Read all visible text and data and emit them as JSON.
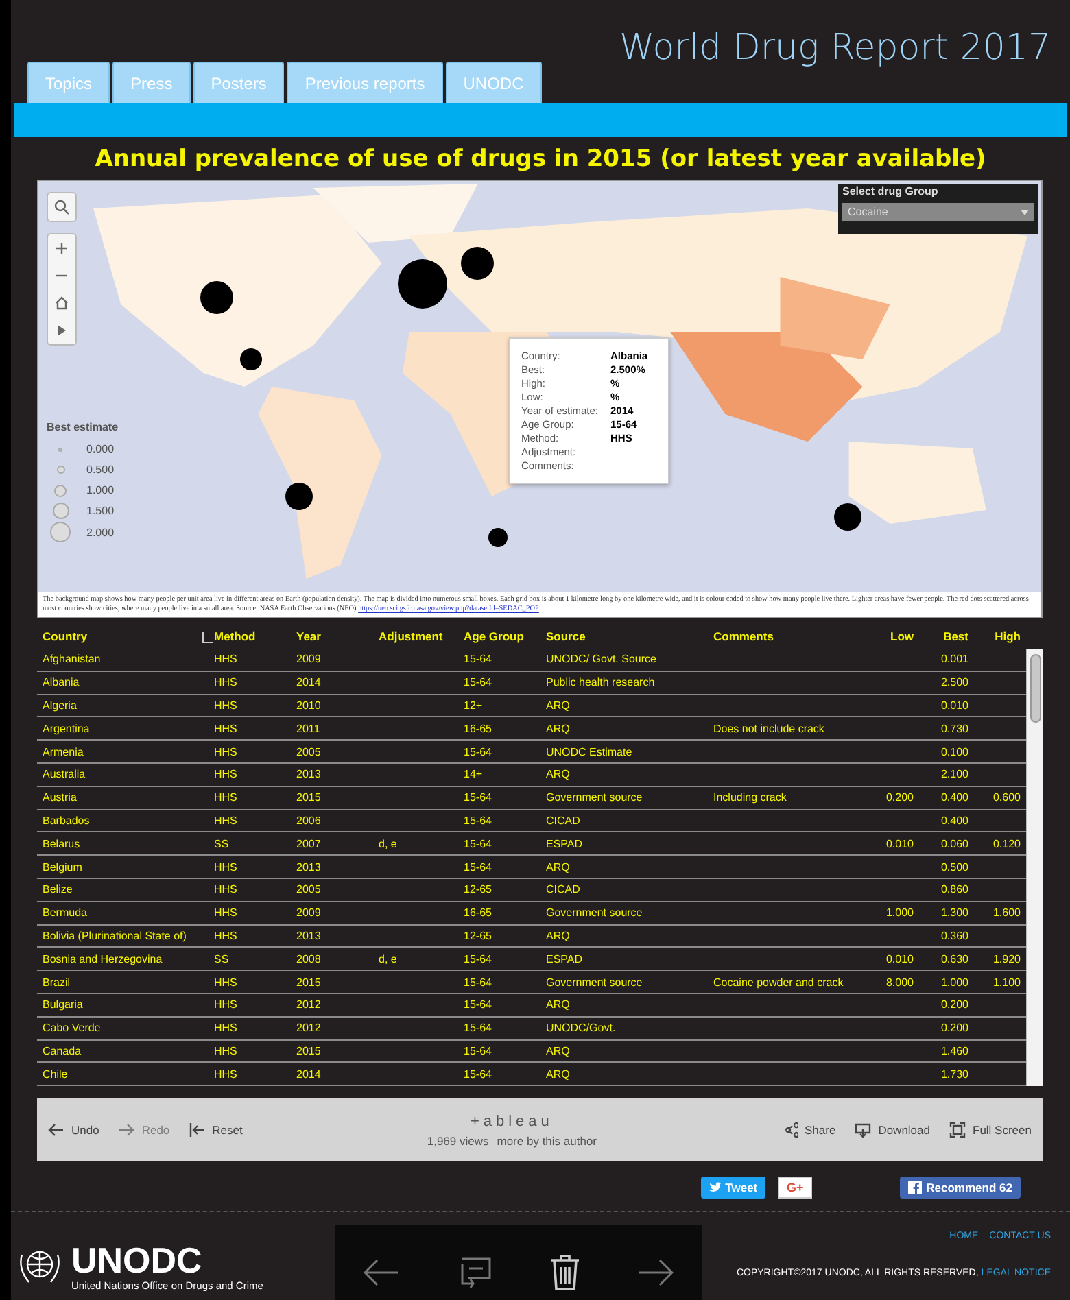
{
  "header": {
    "title": "World Drug Report 2017",
    "tabs": [
      "Topics",
      "Press",
      "Posters",
      "Previous reports",
      "UNODC"
    ]
  },
  "chart_title": "Annual prevalence of use of drugs in 2015 (or latest year available)",
  "map": {
    "kind": "picture",
    "drug_group": {
      "label": "Select drug Group",
      "value": "Cocaine"
    },
    "legend": {
      "title": "Best estimate",
      "items": [
        "0.000",
        "0.500",
        "1.000",
        "1.500",
        "2.000"
      ]
    },
    "tooltip": [
      {
        "label": "Country:",
        "value": "Albania"
      },
      {
        "label": "Best:",
        "value": "2.500%"
      },
      {
        "label": "High:",
        "value": "%"
      },
      {
        "label": "Low:",
        "value": "%"
      },
      {
        "label": "Year of estimate:",
        "value": "2014"
      },
      {
        "label": "Age Group:",
        "value": "15-64"
      },
      {
        "label": "Method:",
        "value": "HHS"
      },
      {
        "label": "Adjustment:"
      },
      {
        "label": "Comments:"
      }
    ],
    "caption": "The background map shows how many people per unit area live in different areas on Earth (population density). The map is divided into numerous small boxes. Each grid box is about 1 kilometre long by one kilometre wide, and it is colour coded to show how many people live there. Lighter areas have fewer people. The red dots scattered across most countries show cities, where many people live in a small area. Source: NASA Earth Observations (NEO)",
    "caption_link": "https://neo.sci.gsfc.nasa.gov/view.php?datasetId=SEDAC_POP"
  },
  "table": {
    "columns": [
      "Country",
      "Method",
      "Year",
      "Adjustment",
      "Age Group",
      "Source",
      "Comments",
      "Low",
      "Best",
      "High"
    ],
    "rows": [
      [
        "Afghanistan",
        "HHS",
        "2009",
        "",
        "15-64",
        "UNODC/ Govt. Source",
        "",
        "",
        "0.001",
        ""
      ],
      [
        "Albania",
        "HHS",
        "2014",
        "",
        "15-64",
        "Public health research",
        "",
        "",
        "2.500",
        ""
      ],
      [
        "Algeria",
        "HHS",
        "2010",
        "",
        "12+",
        "ARQ",
        "",
        "",
        "0.010",
        ""
      ],
      [
        "Argentina",
        "HHS",
        "2011",
        "",
        "16-65",
        "ARQ",
        "Does not include crack",
        "",
        "0.730",
        ""
      ],
      [
        "Armenia",
        "HHS",
        "2005",
        "",
        "15-64",
        "UNODC Estimate",
        "",
        "",
        "0.100",
        ""
      ],
      [
        "Australia",
        "HHS",
        "2013",
        "",
        "14+",
        "ARQ",
        "",
        "",
        "2.100",
        ""
      ],
      [
        "Austria",
        "HHS",
        "2015",
        "",
        "15-64",
        "Government source",
        "Including crack",
        "0.200",
        "0.400",
        "0.600"
      ],
      [
        "Barbados",
        "HHS",
        "2006",
        "",
        "15-64",
        "CICAD",
        "",
        "",
        "0.400",
        ""
      ],
      [
        "Belarus",
        "SS",
        "2007",
        "d, e",
        "15-64",
        "ESPAD",
        "",
        "0.010",
        "0.060",
        "0.120"
      ],
      [
        "Belgium",
        "HHS",
        "2013",
        "",
        "15-64",
        "ARQ",
        "",
        "",
        "0.500",
        ""
      ],
      [
        "Belize",
        "HHS",
        "2005",
        "",
        "12-65",
        "CICAD",
        "",
        "",
        "0.860",
        ""
      ],
      [
        "Bermuda",
        "HHS",
        "2009",
        "",
        "16-65",
        "Government source",
        "",
        "1.000",
        "1.300",
        "1.600"
      ],
      [
        "Bolivia (Plurinational State of)",
        "HHS",
        "2013",
        "",
        "12-65",
        "ARQ",
        "",
        "",
        "0.360",
        ""
      ],
      [
        "Bosnia and Herzegovina",
        "SS",
        "2008",
        "d, e",
        "15-64",
        "ESPAD",
        "",
        "0.010",
        "0.630",
        "1.920"
      ],
      [
        "Brazil",
        "HHS",
        "2015",
        "",
        "15-64",
        "Government source",
        "Cocaine powder and crack",
        "8.000",
        "1.000",
        "1.100"
      ],
      [
        "Bulgaria",
        "HHS",
        "2012",
        "",
        "15-64",
        "ARQ",
        "",
        "",
        "0.200",
        ""
      ],
      [
        "Cabo Verde",
        "HHS",
        "2012",
        "",
        "15-64",
        "UNODC/Govt.",
        "",
        "",
        "0.200",
        ""
      ],
      [
        "Canada",
        "HHS",
        "2015",
        "",
        "15-64",
        "ARQ",
        "",
        "",
        "1.460",
        ""
      ],
      [
        "Chile",
        "HHS",
        "2014",
        "",
        "15-64",
        "ARQ",
        "",
        "",
        "1.730",
        ""
      ]
    ]
  },
  "toolbar": {
    "undo": {
      "label": "Undo",
      "disabled": false
    },
    "redo": {
      "label": "Redo",
      "disabled": true
    },
    "reset": "Reset",
    "logo": "+ableau",
    "views": "1,969 views",
    "author_link": "more by this author",
    "share": "Share",
    "download": "Download",
    "fullscreen": "Full Screen"
  },
  "social": {
    "tweet": "Tweet",
    "gplus": "G+",
    "recommend": "Recommend",
    "recommend_count": "62"
  },
  "footer": {
    "org": "UNODC",
    "org_full": "United Nations Office on Drugs and Crime",
    "links": [
      "HOME",
      "CONTACT US"
    ],
    "copyright": "COPYRIGHT©2017 UNODC, ALL RIGHTS RESERVED,",
    "legal": "LEGAL NOTICE"
  }
}
